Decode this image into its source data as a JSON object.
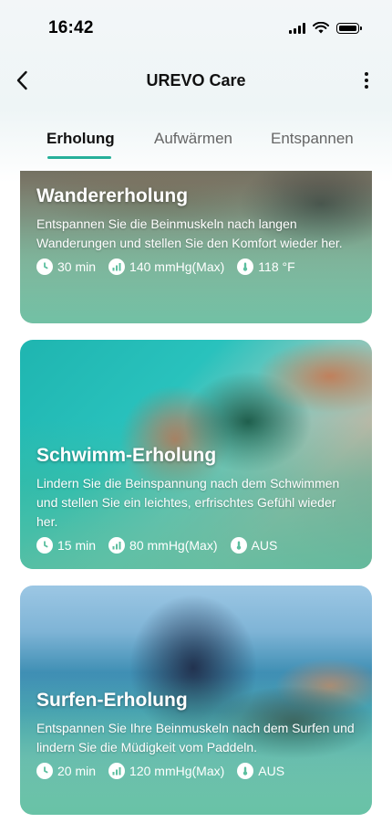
{
  "status_bar": {
    "time": "16:42"
  },
  "header": {
    "title": "UREVO Care"
  },
  "tabs": [
    {
      "label": "Erholung",
      "active": true
    },
    {
      "label": "Aufwärmen",
      "active": false
    },
    {
      "label": "Entspannen",
      "active": false
    }
  ],
  "cards": [
    {
      "title": "Wandererholung",
      "description": "Entspannen Sie die Beinmuskeln nach langen Wanderungen und stellen Sie den Komfort wieder her.",
      "duration": "30 min",
      "pressure": "140 mmHg(Max)",
      "heat": "118 °F"
    },
    {
      "title": "Schwimm-Erholung",
      "description": "Lindern Sie die Beinspannung nach dem Schwimmen und stellen Sie ein leichtes, erfrischtes Gefühl wieder her.",
      "duration": "15 min",
      "pressure": "80 mmHg(Max)",
      "heat": "AUS"
    },
    {
      "title": "Surfen-Erholung",
      "description": "Entspannen Sie Ihre Beinmuskeln nach dem Surfen und lindern Sie die Müdigkeit vom Paddeln.",
      "duration": "20 min",
      "pressure": "120 mmHg(Max)",
      "heat": "AUS"
    }
  ],
  "icons": {
    "back": "chevron-left-icon",
    "more": "more-vertical-icon",
    "duration": "clock-icon",
    "pressure": "signal-bars-icon",
    "heat": "thermometer-icon"
  },
  "colors": {
    "accent": "#26b09a",
    "card_overlay": "#3fb89a"
  }
}
